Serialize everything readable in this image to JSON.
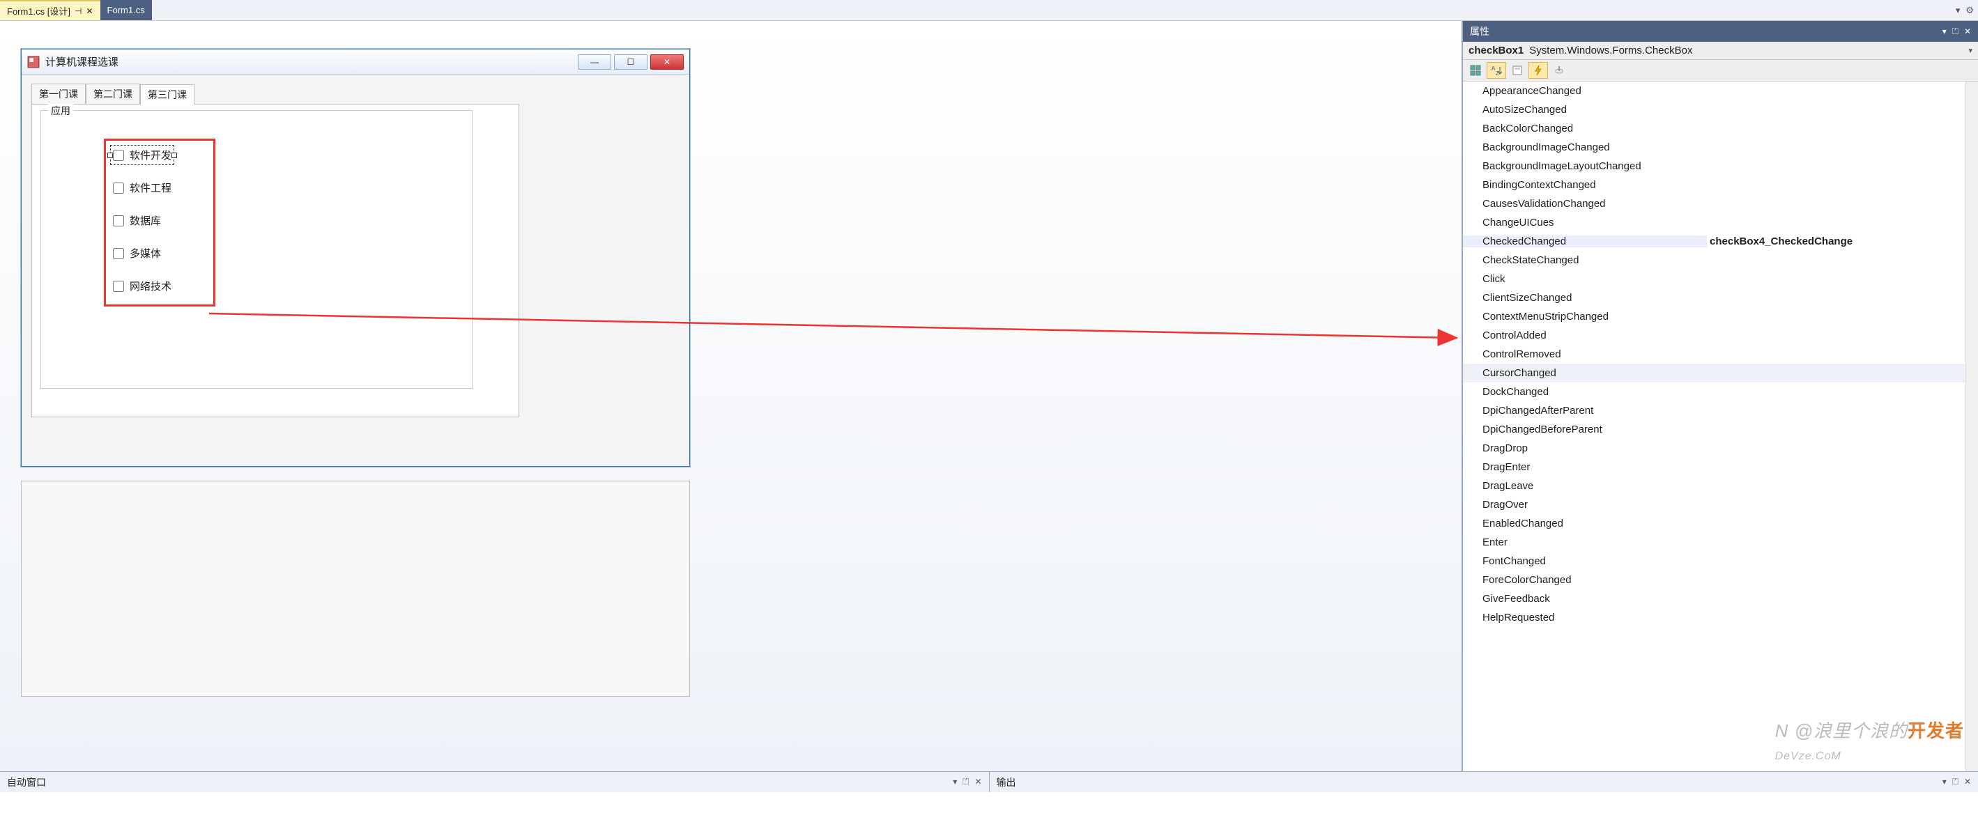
{
  "tabs": {
    "active": "Form1.cs [设计]",
    "inactive": "Form1.cs"
  },
  "props_panel": {
    "title": "属性",
    "object_name": "checkBox1",
    "object_type": "System.Windows.Forms.CheckBox",
    "events": [
      {
        "name": "AppearanceChanged",
        "value": ""
      },
      {
        "name": "AutoSizeChanged",
        "value": ""
      },
      {
        "name": "BackColorChanged",
        "value": ""
      },
      {
        "name": "BackgroundImageChanged",
        "value": ""
      },
      {
        "name": "BackgroundImageLayoutChanged",
        "value": ""
      },
      {
        "name": "BindingContextChanged",
        "value": ""
      },
      {
        "name": "CausesValidationChanged",
        "value": ""
      },
      {
        "name": "ChangeUICues",
        "value": ""
      },
      {
        "name": "CheckedChanged",
        "value": "checkBox4_CheckedChange"
      },
      {
        "name": "CheckStateChanged",
        "value": ""
      },
      {
        "name": "Click",
        "value": ""
      },
      {
        "name": "ClientSizeChanged",
        "value": ""
      },
      {
        "name": "ContextMenuStripChanged",
        "value": ""
      },
      {
        "name": "ControlAdded",
        "value": ""
      },
      {
        "name": "ControlRemoved",
        "value": ""
      },
      {
        "name": "CursorChanged",
        "value": ""
      },
      {
        "name": "DockChanged",
        "value": ""
      },
      {
        "name": "DpiChangedAfterParent",
        "value": ""
      },
      {
        "name": "DpiChangedBeforeParent",
        "value": ""
      },
      {
        "name": "DragDrop",
        "value": ""
      },
      {
        "name": "DragEnter",
        "value": ""
      },
      {
        "name": "DragLeave",
        "value": ""
      },
      {
        "name": "DragOver",
        "value": ""
      },
      {
        "name": "EnabledChanged",
        "value": ""
      },
      {
        "name": "Enter",
        "value": ""
      },
      {
        "name": "FontChanged",
        "value": ""
      },
      {
        "name": "ForeColorChanged",
        "value": ""
      },
      {
        "name": "GiveFeedback",
        "value": ""
      },
      {
        "name": "HelpRequested",
        "value": ""
      }
    ],
    "hover_event": "CursorChanged"
  },
  "form": {
    "title": "计算机课程选课",
    "tabs": [
      "第一门课",
      "第二门课",
      "第三门课"
    ],
    "active_tab_index": 2,
    "groupbox_title": "应用",
    "checkboxes": [
      "软件开发",
      "软件工程",
      "数据库",
      "多媒体",
      "网络技术"
    ],
    "selected_checkbox_index": 0
  },
  "bottom": {
    "left": "自动窗口",
    "right": "输出"
  },
  "watermark": {
    "text": "N @浪里个浪的",
    "brand": "开发者",
    "sub": "DeVze.CoM"
  }
}
